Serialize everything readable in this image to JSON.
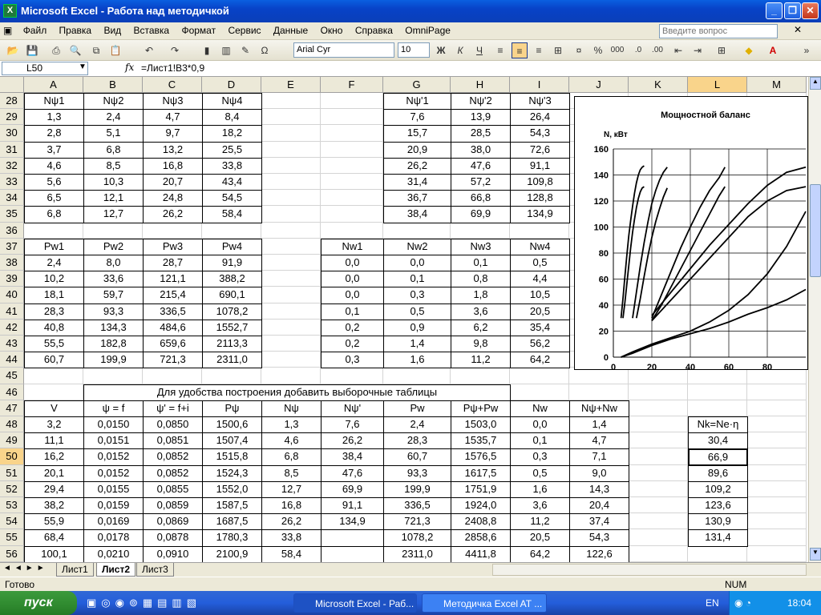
{
  "window": {
    "title": "Microsoft Excel - Работа над методичкой",
    "app_icon": "excel-icon"
  },
  "menu": [
    "Файл",
    "Правка",
    "Вид",
    "Вставка",
    "Формат",
    "Сервис",
    "Данные",
    "Окно",
    "Справка",
    "OmniPage"
  ],
  "help_placeholder": "Введите вопрос",
  "toolbar": {
    "font": "Arial Cyr",
    "size": "10",
    "bold": "Ж",
    "italic": "К",
    "underline": "Ч",
    "percent": "%",
    "thousands": "000",
    "currency_sym": "Σ"
  },
  "formula": {
    "name_box": "L50",
    "fx": "fx",
    "content": "=Лист1!B3*0,9"
  },
  "columns": [
    "A",
    "B",
    "C",
    "D",
    "E",
    "F",
    "G",
    "H",
    "I",
    "J",
    "K",
    "L",
    "M"
  ],
  "rows": [
    "28",
    "29",
    "30",
    "31",
    "32",
    "33",
    "34",
    "35",
    "36",
    "37",
    "38",
    "39",
    "40",
    "41",
    "42",
    "43",
    "44",
    "45",
    "46",
    "47",
    "48",
    "49",
    "50",
    "51",
    "52",
    "53",
    "54",
    "55",
    "56"
  ],
  "t1": {
    "headers": [
      "Nψ1",
      "Nψ2",
      "Nψ3",
      "Nψ4"
    ],
    "data": [
      [
        "1,3",
        "2,4",
        "4,7",
        "8,4"
      ],
      [
        "2,8",
        "5,1",
        "9,7",
        "18,2"
      ],
      [
        "3,7",
        "6,8",
        "13,2",
        "25,5"
      ],
      [
        "4,6",
        "8,5",
        "16,8",
        "33,8"
      ],
      [
        "5,6",
        "10,3",
        "20,7",
        "43,4"
      ],
      [
        "6,5",
        "12,1",
        "24,8",
        "54,5"
      ],
      [
        "6,8",
        "12,7",
        "26,2",
        "58,4"
      ]
    ]
  },
  "t2": {
    "headers": [
      "Nψ'1",
      "Nψ'2",
      "Nψ'3"
    ],
    "data": [
      [
        "7,6",
        "13,9",
        "26,4"
      ],
      [
        "15,7",
        "28,5",
        "54,3"
      ],
      [
        "20,9",
        "38,0",
        "72,6"
      ],
      [
        "26,2",
        "47,6",
        "91,1"
      ],
      [
        "31,4",
        "57,2",
        "109,8"
      ],
      [
        "36,7",
        "66,8",
        "128,8"
      ],
      [
        "38,4",
        "69,9",
        "134,9"
      ]
    ]
  },
  "t3": {
    "headers": [
      "Pw1",
      "Pw2",
      "Pw3",
      "Pw4"
    ],
    "data": [
      [
        "2,4",
        "8,0",
        "28,7",
        "91,9"
      ],
      [
        "10,2",
        "33,6",
        "121,1",
        "388,2"
      ],
      [
        "18,1",
        "59,7",
        "215,4",
        "690,1"
      ],
      [
        "28,3",
        "93,3",
        "336,5",
        "1078,2"
      ],
      [
        "40,8",
        "134,3",
        "484,6",
        "1552,7"
      ],
      [
        "55,5",
        "182,8",
        "659,6",
        "2113,3"
      ],
      [
        "60,7",
        "199,9",
        "721,3",
        "2311,0"
      ]
    ]
  },
  "t4": {
    "headers": [
      "Nw1",
      "Nw2",
      "Nw3",
      "Nw4"
    ],
    "data": [
      [
        "0,0",
        "0,0",
        "0,1",
        "0,5"
      ],
      [
        "0,0",
        "0,1",
        "0,8",
        "4,4"
      ],
      [
        "0,0",
        "0,3",
        "1,8",
        "10,5"
      ],
      [
        "0,1",
        "0,5",
        "3,6",
        "20,5"
      ],
      [
        "0,2",
        "0,9",
        "6,2",
        "35,4"
      ],
      [
        "0,2",
        "1,4",
        "9,8",
        "56,2"
      ],
      [
        "0,3",
        "1,6",
        "11,2",
        "64,2"
      ]
    ]
  },
  "t5": {
    "caption": "Для удобства построения добавить выборочные таблицы",
    "headers": [
      "V",
      "ψ = f",
      "ψ' = f+i",
      "Pψ",
      "Nψ",
      "Nψ'",
      "Pw",
      "Pψ+Pw",
      "Nw",
      "Nψ+Nw"
    ],
    "data": [
      [
        "3,2",
        "0,0150",
        "0,0850",
        "1500,6",
        "1,3",
        "7,6",
        "2,4",
        "1503,0",
        "0,0",
        "1,4"
      ],
      [
        "11,1",
        "0,0151",
        "0,0851",
        "1507,4",
        "4,6",
        "26,2",
        "28,3",
        "1535,7",
        "0,1",
        "4,7"
      ],
      [
        "16,2",
        "0,0152",
        "0,0852",
        "1515,8",
        "6,8",
        "38,4",
        "60,7",
        "1576,5",
        "0,3",
        "7,1"
      ],
      [
        "20,1",
        "0,0152",
        "0,0852",
        "1524,3",
        "8,5",
        "47,6",
        "93,3",
        "1617,5",
        "0,5",
        "9,0"
      ],
      [
        "29,4",
        "0,0155",
        "0,0855",
        "1552,0",
        "12,7",
        "69,9",
        "199,9",
        "1751,9",
        "1,6",
        "14,3"
      ],
      [
        "38,2",
        "0,0159",
        "0,0859",
        "1587,5",
        "16,8",
        "91,1",
        "336,5",
        "1924,0",
        "3,6",
        "20,4"
      ],
      [
        "55,9",
        "0,0169",
        "0,0869",
        "1687,5",
        "26,2",
        "134,9",
        "721,3",
        "2408,8",
        "11,2",
        "37,4"
      ],
      [
        "68,4",
        "0,0178",
        "0,0878",
        "1780,3",
        "33,8",
        "",
        "1078,2",
        "2858,6",
        "20,5",
        "54,3"
      ],
      [
        "100,1",
        "0,0210",
        "0,0910",
        "2100,9",
        "58,4",
        "",
        "2311,0",
        "4411,8",
        "64,2",
        "122,6"
      ]
    ]
  },
  "t6": {
    "header": "Nk=Ne·η",
    "data": [
      "30,4",
      "66,9",
      "89,6",
      "109,2",
      "123,6",
      "130,9",
      "131,4"
    ]
  },
  "chart_data": {
    "type": "line",
    "title": "Мощностной баланс",
    "ylabel": "N, кВт",
    "xlabel": "",
    "xlim": [
      0,
      100
    ],
    "ylim": [
      0,
      160
    ],
    "xticks": [
      "0",
      "20",
      "40",
      "60",
      "80"
    ],
    "yticks": [
      "0",
      "20",
      "40",
      "60",
      "80",
      "100",
      "120",
      "140",
      "160"
    ],
    "series": [
      {
        "x": [
          4,
          5,
          6,
          7,
          8,
          9,
          10,
          11,
          12,
          13,
          14,
          15,
          16
        ],
        "y": [
          30,
          45,
          62,
          78,
          93,
          105,
          116,
          126,
          134,
          140,
          144,
          146,
          147
        ]
      },
      {
        "x": [
          5,
          6,
          7,
          8,
          9,
          10,
          11,
          12,
          13,
          14,
          15,
          16
        ],
        "y": [
          30,
          42,
          56,
          70,
          84,
          96,
          106,
          115,
          122,
          127,
          130,
          131
        ]
      },
      {
        "x": [
          10,
          12,
          14,
          16,
          18,
          20,
          22,
          24,
          26,
          28
        ],
        "y": [
          30,
          50,
          70,
          88,
          104,
          118,
          128,
          136,
          142,
          146
        ]
      },
      {
        "x": [
          12,
          14,
          16,
          18,
          20,
          22,
          24,
          26,
          28
        ],
        "y": [
          30,
          45,
          62,
          78,
          92,
          104,
          114,
          123,
          130
        ]
      },
      {
        "x": [
          20,
          25,
          30,
          35,
          40,
          45,
          50,
          55,
          58
        ],
        "y": [
          30,
          48,
          66,
          84,
          100,
          115,
          128,
          138,
          146
        ]
      },
      {
        "x": [
          20,
          25,
          30,
          35,
          40,
          45,
          50,
          55,
          58
        ],
        "y": [
          28,
          40,
          54,
          68,
          82,
          96,
          110,
          124,
          131
        ]
      },
      {
        "x": [
          20,
          30,
          40,
          50,
          60,
          70,
          80,
          90,
          100
        ],
        "y": [
          32,
          50,
          68,
          86,
          102,
          118,
          132,
          142,
          146
        ]
      },
      {
        "x": [
          20,
          30,
          40,
          50,
          60,
          70,
          80,
          90,
          100
        ],
        "y": [
          28,
          44,
          60,
          76,
          92,
          108,
          120,
          128,
          131
        ]
      },
      {
        "x": [
          4,
          10,
          20,
          30,
          40,
          50,
          60,
          70,
          80,
          90,
          100
        ],
        "y": [
          0,
          4,
          10,
          15,
          20,
          27,
          36,
          48,
          64,
          85,
          112
        ]
      },
      {
        "x": [
          4,
          10,
          20,
          30,
          40,
          50,
          60,
          70,
          80,
          90,
          100
        ],
        "y": [
          0,
          3,
          9,
          14,
          18,
          22,
          27,
          33,
          38,
          44,
          52
        ]
      }
    ]
  },
  "sheets": [
    "Лист1",
    "Лист2",
    "Лист3"
  ],
  "status": {
    "left": "Готово",
    "num": "NUM"
  },
  "taskbar": {
    "start": "пуск",
    "tasks": [
      "Microsoft Excel - Раб...",
      "Методичка Excel AT ..."
    ],
    "lang": "EN",
    "time": "18:04"
  }
}
